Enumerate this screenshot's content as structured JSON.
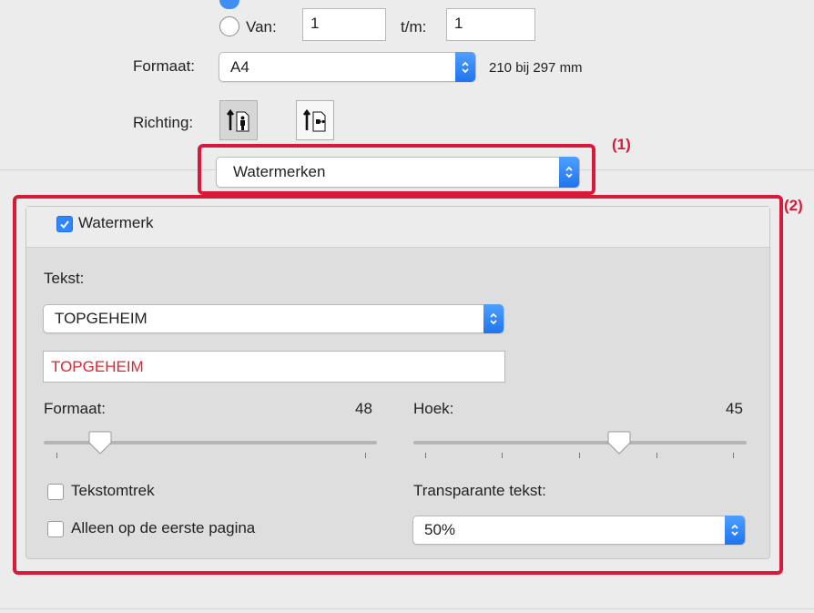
{
  "range": {
    "van_label": "Van:",
    "van_value": "1",
    "tm_label": "t/m:",
    "tm_value": "1"
  },
  "paper": {
    "format_label": "Formaat:",
    "format_value": "A4",
    "format_size": "210 bij 297 mm",
    "orientation_label": "Richting:",
    "orientation_options": [
      "portrait-icon",
      "landscape-icon"
    ],
    "orientation_selected": "portrait"
  },
  "section_popup": {
    "value": "Watermerken",
    "annotation": "(1)"
  },
  "watermark": {
    "annotation": "(2)",
    "enabled_label": "Watermerk",
    "enabled": true,
    "text_label": "Tekst:",
    "text_preset": "TOPGEHEIM",
    "text_value": "TOPGEHEIM",
    "text_color": "#e0242e",
    "size_label": "Formaat:",
    "size_value": "48",
    "angle_label": "Hoek:",
    "angle_value": "45",
    "outline_label": "Tekstomtrek",
    "outline_checked": false,
    "first_page_label": "Alleen op de eerste pagina",
    "first_page_checked": false,
    "transparency_label": "Transparante tekst:",
    "transparency_value": "50%"
  },
  "colors": {
    "accent": "#2f86ff",
    "annotation_red": "#d8193a"
  }
}
